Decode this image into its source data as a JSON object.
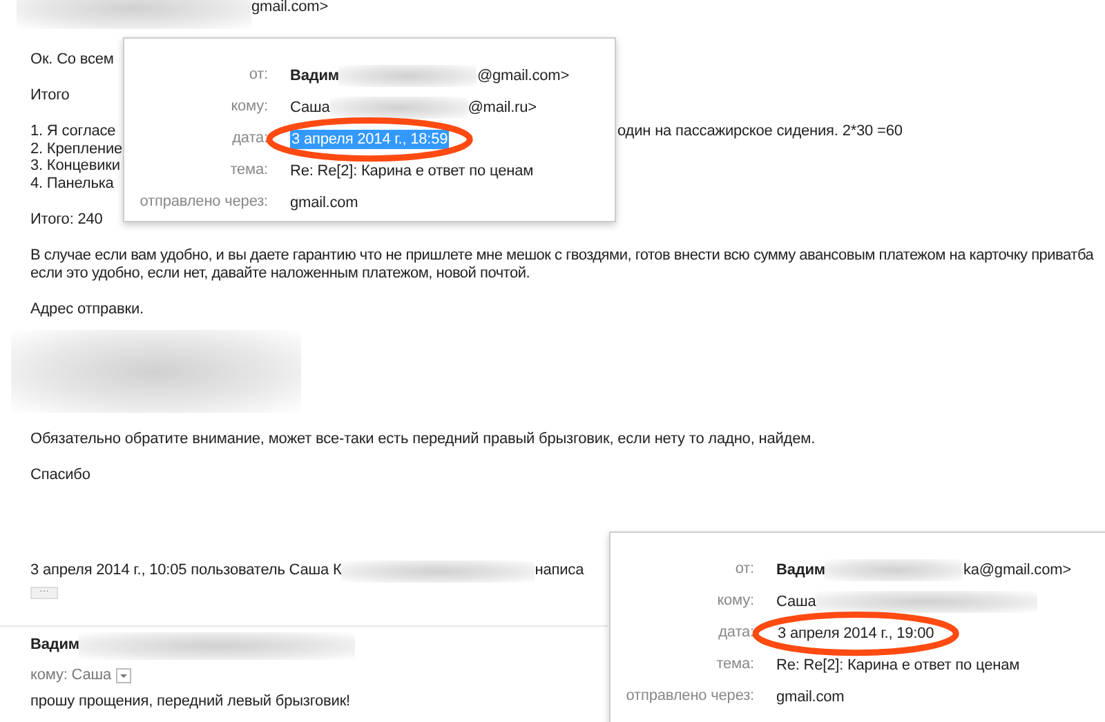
{
  "header_fragment": "gmail.com>",
  "body": [
    {
      "kind": "text",
      "lines": [
        "Ок. Со всем"
      ]
    },
    {
      "kind": "text",
      "lines": [
        "Итого"
      ]
    },
    {
      "kind": "list",
      "items": [
        {
          "text": "1.  Я согласе",
          "tail": "один на пассажирское сидения. 2*30 =60"
        },
        {
          "text": "2. Крепление"
        },
        {
          "text": "3. Концевики"
        },
        {
          "text": "4. Панелька"
        }
      ]
    },
    {
      "kind": "text",
      "lines": [
        "Итого: 240"
      ]
    },
    {
      "kind": "text",
      "lines": [
        "В случае если вам удобно, и вы даете гарантию что не пришлете мне мешок с гвоздями, готов внести всю сумму авансовым платежом на карточку приватба",
        "если это удобно, если нет, давайте наложенным платежом, новой почтой."
      ]
    },
    {
      "kind": "text",
      "lines": [
        "Адрес отправки."
      ]
    },
    {
      "kind": "redacted"
    },
    {
      "kind": "text",
      "lines": [
        "Обязательно обратите внимание, может все-таки есть передний правый брызговик, если нету то ладно, найдем."
      ]
    },
    {
      "kind": "text",
      "lines": [
        "Спасибо"
      ]
    }
  ],
  "quote_header": {
    "before": "3 апреля 2014 г., 10:05 пользователь Саша К",
    "after": "написа"
  },
  "quote_toggle": "···",
  "reply": {
    "sender": "Вадим",
    "to_label": "кому: Саша",
    "text": "прошу прощения, передний левый брызговик!"
  },
  "popups": [
    {
      "rows": [
        {
          "kind": "sender",
          "label": "от:",
          "value": "Вадим",
          "suffix": "@gmail.com>"
        },
        {
          "kind": "person",
          "label": "кому:",
          "value": "Саша",
          "suffix": "@mail.ru>"
        },
        {
          "kind": "date",
          "label": "дата:",
          "value": "3 апреля 2014 г., 18:59",
          "selected": true,
          "circled": true
        },
        {
          "kind": "plain",
          "label": "тема:",
          "value": "Re: Re[2]: Карина е ответ по ценам"
        },
        {
          "kind": "plain",
          "label": "отправлено через:",
          "value": "gmail.com"
        }
      ]
    },
    {
      "rows": [
        {
          "kind": "sender",
          "label": "от:",
          "value": "Вадим",
          "suffix": "ka@gmail.com>"
        },
        {
          "kind": "person",
          "label": "кому:",
          "value": "Саша"
        },
        {
          "kind": "date",
          "label": "дата:",
          "value": "3 апреля 2014 г., 19:00",
          "selected": false,
          "circled": true
        },
        {
          "kind": "plain",
          "label": "тема:",
          "value": "Re: Re[2]: Карина е ответ по ценам"
        },
        {
          "kind": "plain",
          "label": "отправлено через:",
          "value": "gmail.com"
        }
      ]
    }
  ]
}
